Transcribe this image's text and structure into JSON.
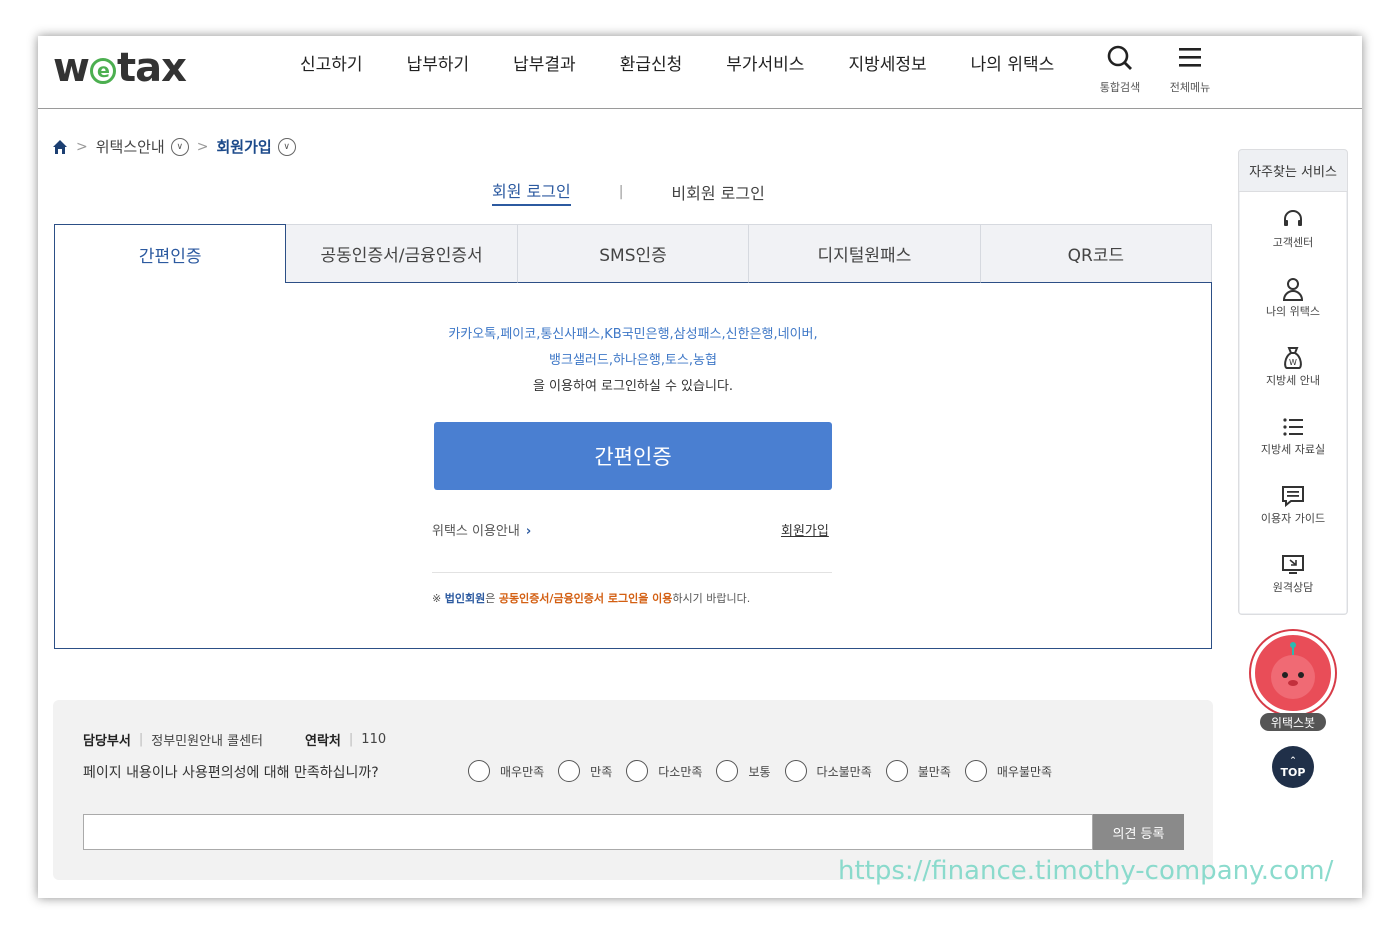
{
  "header": {
    "logo_pre": "w",
    "logo_e": "e",
    "logo_post": "tax",
    "menu": [
      "신고하기",
      "납부하기",
      "납부결과",
      "환급신청",
      "부가서비스",
      "지방세정보",
      "나의 위택스"
    ],
    "search_label": "통합검색",
    "allmenu_label": "전체메뉴"
  },
  "breadcrumb": {
    "item1": "위택스안내",
    "current": "회원가입"
  },
  "login_tabs": {
    "member": "회원 로그인",
    "separator": "|",
    "guest": "비회원 로그인"
  },
  "auth_tabs": [
    "간편인증",
    "공동인증서/금융인증서",
    "SMS인증",
    "디지털원패스",
    "QR코드"
  ],
  "simple_auth": {
    "providers_line1": "카카오톡,페이코,통신사패스,KB국민은행,삼성패스,신한은행,네이버,",
    "providers_line2": "뱅크샐러드,하나은행,토스,농협",
    "desc": "을 이용하여 로그인하실 수 있습니다.",
    "button": "간편인증",
    "guide_link": "위택스 이용안내",
    "join_link": "회원가입",
    "notice_prefix": "※ ",
    "notice_b1": "법인회원",
    "notice_t1": "은 ",
    "notice_o1": "공동인증서/금융인증서 로그인을 이용",
    "notice_t2": "하시기 바랍니다."
  },
  "survey": {
    "dept_label": "담당부서",
    "dept_value": "정부민원안내 콜센터",
    "contact_label": "연락처",
    "contact_value": "110",
    "question": "페이지 내용이나 사용편의성에 대해 만족하십니까?",
    "options": [
      "매우만족",
      "만족",
      "다소만족",
      "보통",
      "다소불만족",
      "불만족",
      "매우불만족"
    ],
    "submit": "의견 등록"
  },
  "quick_menu": {
    "title": "자주찾는 서비스",
    "items": [
      "고객센터",
      "나의 위택스",
      "지방세 안내",
      "지방세 자료실",
      "이용자 가이드",
      "원격상담"
    ]
  },
  "bot_label": "위택스봇",
  "top_label": "TOP",
  "watermark": "https://finance.timothy-company.com/",
  "colors": {
    "accent": "#2c5aa0",
    "button": "#4a7fd1",
    "notice_orange": "#d35f12",
    "logo_green": "#4caf50"
  }
}
